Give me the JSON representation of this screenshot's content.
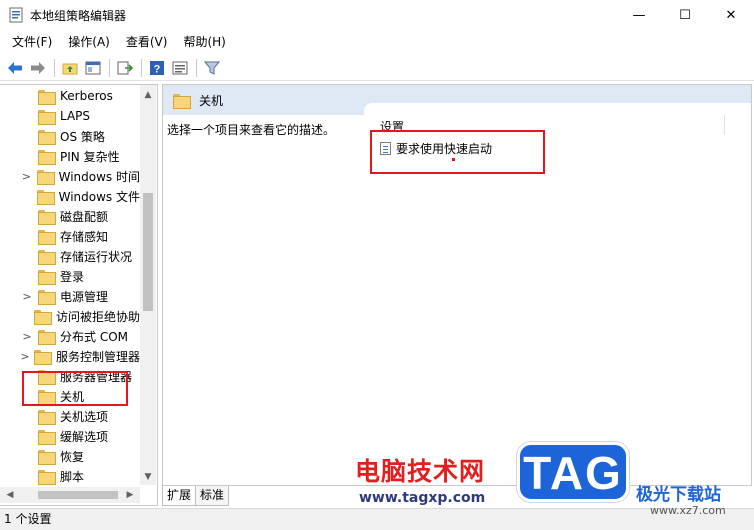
{
  "window": {
    "title": "本地组策略编辑器",
    "minimize": "—",
    "maximize": "☐",
    "close": "✕"
  },
  "menu": [
    "文件(F)",
    "操作(A)",
    "查看(V)",
    "帮助(H)"
  ],
  "tree": {
    "items": [
      {
        "label": "Kerberos",
        "expand": ""
      },
      {
        "label": "LAPS",
        "expand": ""
      },
      {
        "label": "OS 策略",
        "expand": ""
      },
      {
        "label": "PIN 复杂性",
        "expand": ""
      },
      {
        "label": "Windows 时间",
        "expand": ">"
      },
      {
        "label": "Windows 文件",
        "expand": ""
      },
      {
        "label": "磁盘配额",
        "expand": ""
      },
      {
        "label": "存储感知",
        "expand": ""
      },
      {
        "label": "存储运行状况",
        "expand": ""
      },
      {
        "label": "登录",
        "expand": ""
      },
      {
        "label": "电源管理",
        "expand": ">"
      },
      {
        "label": "访问被拒绝协助",
        "expand": ""
      },
      {
        "label": "分布式 COM",
        "expand": ">"
      },
      {
        "label": "服务控制管理器",
        "expand": ">"
      },
      {
        "label": "服务器管理器",
        "expand": ""
      },
      {
        "label": "关机",
        "expand": ""
      },
      {
        "label": "关机选项",
        "expand": ""
      },
      {
        "label": "缓解选项",
        "expand": ""
      },
      {
        "label": "恢复",
        "expand": ""
      },
      {
        "label": "脚本",
        "expand": ""
      }
    ]
  },
  "pane": {
    "header": "关机",
    "description": "选择一个项目来查看它的描述。",
    "column_header": "设置",
    "setting": "要求使用快速启动"
  },
  "tabs": [
    "扩展",
    "标准"
  ],
  "status": "1 个设置",
  "watermark": {
    "site_name": "电脑技术网",
    "url": "www.tagxp.com",
    "logo": "TAG",
    "right_name": "极光下载站",
    "right_url": "www.xz7.com"
  },
  "colors": {
    "highlight": "#e6151f",
    "header_bg": "#dfe8f5",
    "logo_bg": "#1d64d8"
  }
}
